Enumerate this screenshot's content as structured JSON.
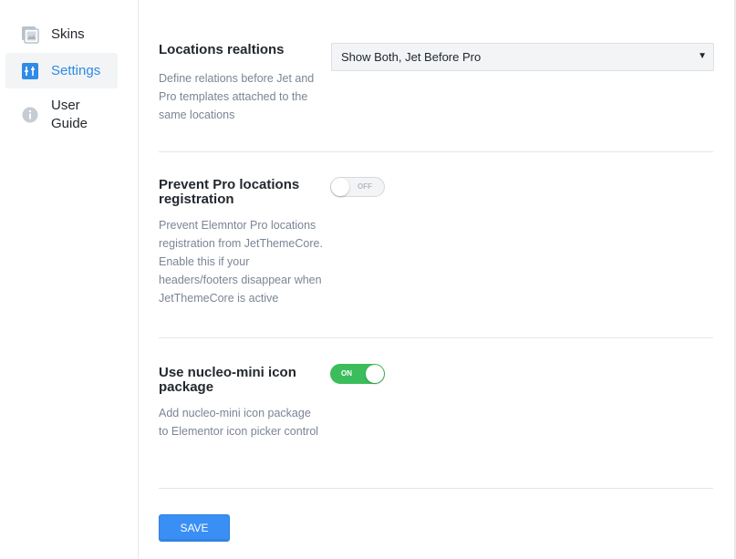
{
  "sidebar": {
    "items": [
      {
        "label": "Skins",
        "icon": "skins-icon"
      },
      {
        "label": "Settings",
        "icon": "settings-icon",
        "active": true
      },
      {
        "label": "User Guide",
        "icon": "info-icon"
      }
    ]
  },
  "settings": {
    "locations": {
      "title": "Locations realtions",
      "description": "Define relations before Jet and Pro templates attached to the same locations",
      "select_value": "Show Both, Jet Before Pro"
    },
    "prevent_pro": {
      "title": "Prevent Pro locations registration",
      "description": "Prevent Elemntor Pro locations registration from JetThemeCore. Enable this if your headers/footers disappear when JetThemeCore is active",
      "toggle_label": "OFF",
      "enabled": false
    },
    "nucleo": {
      "title": "Use nucleo-mini icon package",
      "description": "Add nucleo-mini icon package to Elementor icon picker control",
      "toggle_label": "ON",
      "enabled": true
    }
  },
  "save_label": "SAVE",
  "colors": {
    "accent": "#2e8be6",
    "toggle_on": "#3cbd5b",
    "save_button": "#3a8ff5"
  }
}
